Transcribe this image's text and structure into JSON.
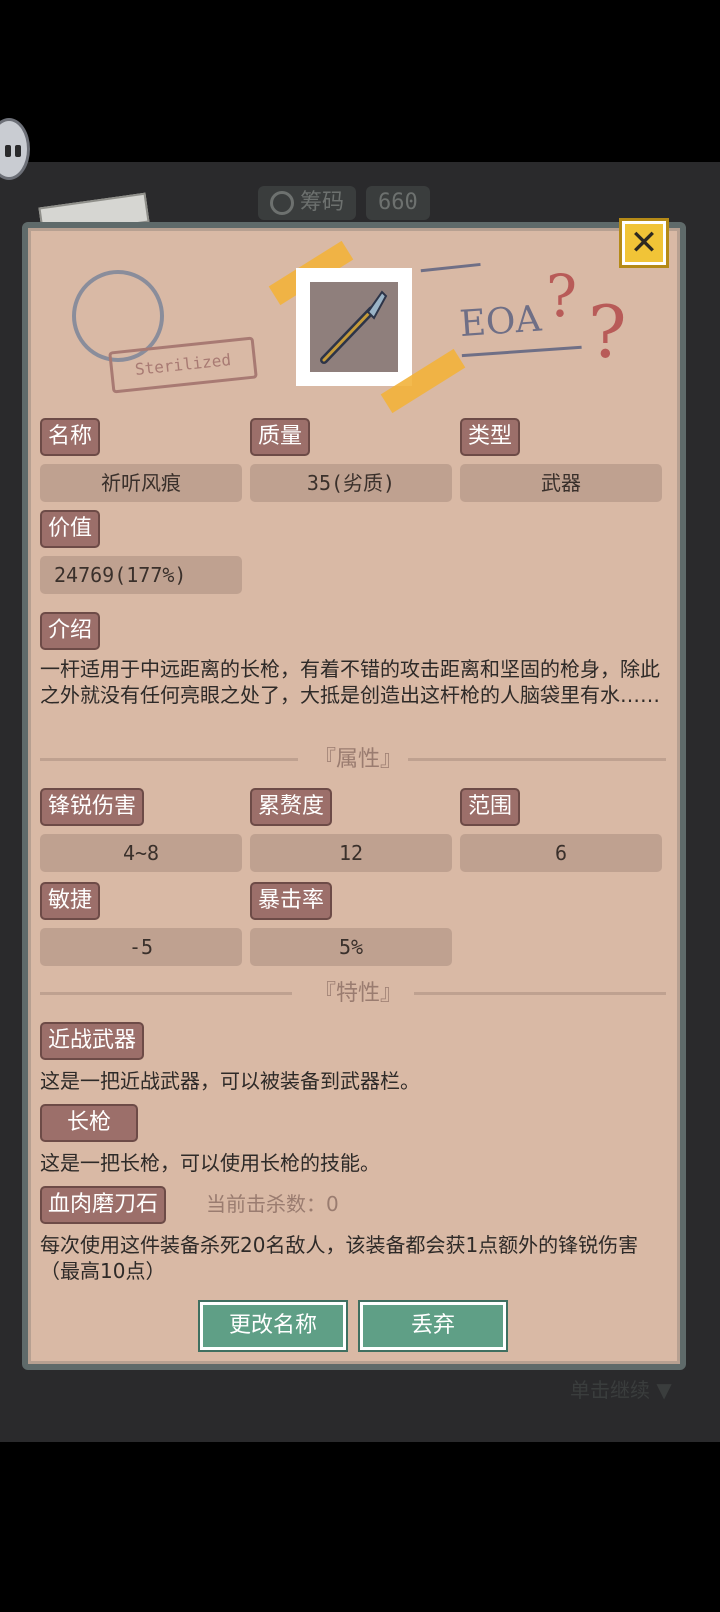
{
  "top": {
    "currency_label": "筹码",
    "currency_value": "660"
  },
  "header": {
    "stamp_text": "Sterilized",
    "logo_text": "EOA"
  },
  "fields": {
    "name_label": "名称",
    "name_value": "祈听风痕",
    "quality_label": "质量",
    "quality_value": "35(劣质)",
    "type_label": "类型",
    "type_value": "武器",
    "value_label": "价值",
    "value_value": "24769(177%)"
  },
  "intro": {
    "label": "介绍",
    "text": "一杆适用于中远距离的长枪，有着不错的攻击距离和坚固的枪身，除此之外就没有任何亮眼之处了，大抵是创造出这杆枪的人脑袋里有水……"
  },
  "attributes": {
    "title": "『属性』",
    "items": [
      {
        "label": "锋锐伤害",
        "value": "4~8"
      },
      {
        "label": "累赘度",
        "value": "12"
      },
      {
        "label": "范围",
        "value": "6"
      },
      {
        "label": "敏捷",
        "value": "-5"
      },
      {
        "label": "暴击率",
        "value": "5%"
      }
    ]
  },
  "traits": {
    "title": "『特性』",
    "items": [
      {
        "label": "近战武器",
        "desc": "这是一把近战武器，可以被装备到武器栏。"
      },
      {
        "label": "长枪",
        "desc": "这是一把长枪，可以使用长枪的技能。"
      },
      {
        "label": "血肉磨刀石",
        "extra": "当前击杀数：0",
        "desc": "每次使用这件装备杀死20名敌人，该装备都会获1点额外的锋锐伤害（最高10点）"
      }
    ]
  },
  "buttons": {
    "rename": "更改名称",
    "discard": "丢弃",
    "close": "✕"
  },
  "footer": {
    "continue_text": "单击继续"
  },
  "colors": {
    "panel_bg": "#d9b9a5",
    "label_bg": "#9c6f6a",
    "value_bg": "#bfa190",
    "button_bg": "#5f9f86",
    "close_bg": "#f1c437"
  }
}
